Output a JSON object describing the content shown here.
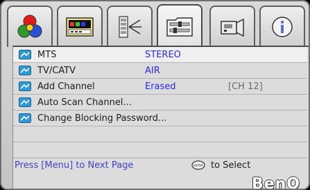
{
  "tabs": [
    {
      "icon": "color-balls-icon",
      "active": false
    },
    {
      "icon": "screen-settings-icon",
      "active": false
    },
    {
      "icon": "projector-light-icon",
      "active": false
    },
    {
      "icon": "tv-tuner-settings-icon",
      "active": true
    },
    {
      "icon": "projector-setup-icon",
      "active": false
    },
    {
      "icon": "info-icon",
      "active": false
    }
  ],
  "menu": {
    "rows": [
      {
        "label": "MTS",
        "value": "STEREO",
        "extra": "",
        "selected": true
      },
      {
        "label": "TV/CATV",
        "value": "AIR",
        "extra": ""
      },
      {
        "label": "Add Channel",
        "value": "Erased",
        "extra": "[CH 12]"
      },
      {
        "label": "Auto Scan Channel...",
        "value": "",
        "extra": ""
      },
      {
        "label": "Change Blocking Password...",
        "value": "",
        "extra": ""
      }
    ]
  },
  "footer": {
    "left_hint": "Press [Menu] to Next Page",
    "enter_label": "ENTER",
    "right_hint": "to Select",
    "logo": "BenQ"
  },
  "colors": {
    "value_text": "#2a2ae0",
    "hint_text": "#3c44c8"
  }
}
